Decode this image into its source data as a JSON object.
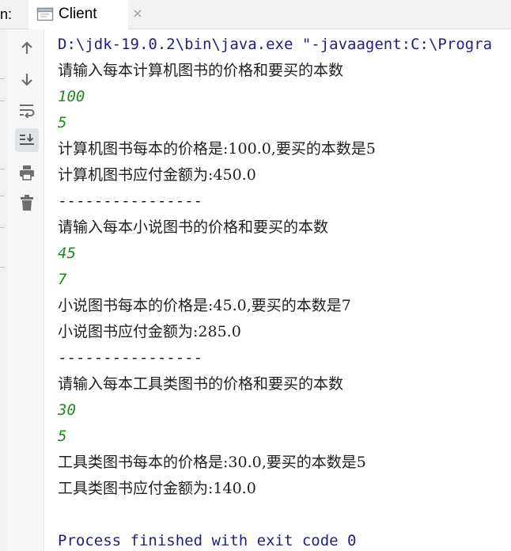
{
  "run_label": "n:",
  "tab": {
    "title": "Client",
    "close": "×"
  },
  "toolbar": {
    "icons": [
      "arrow-up-icon",
      "arrow-down-icon",
      "soft-wrap-icon",
      "scroll-to-end-icon",
      "print-icon",
      "trash-icon"
    ]
  },
  "console": {
    "lines": [
      "D:\\jdk-19.0.2\\bin\\java.exe \"-javaagent:C:\\Progra",
      "请输入每本计算机图书的价格和要买的本数",
      "100",
      "5",
      "计算机图书每本的价格是:100.0,要买的本数是5",
      "计算机图书应付金额为:450.0",
      "----------------",
      "请输入每本小说图书的价格和要买的本数",
      "45",
      "7",
      "小说图书每本的价格是:45.0,要买的本数是7",
      "小说图书应付金额为:285.0",
      "----------------",
      "请输入每本工具类图书的价格和要买的本数",
      "30",
      "5",
      "工具类图书每本的价格是:30.0,要买的本数是5",
      "工具类图书应付金额为:140.0",
      "",
      "Process finished with exit code 0"
    ]
  },
  "colors": {
    "input_text": "#1f8a1f",
    "system_text": "#1f1f80",
    "output_text": "#1f1f1f"
  }
}
